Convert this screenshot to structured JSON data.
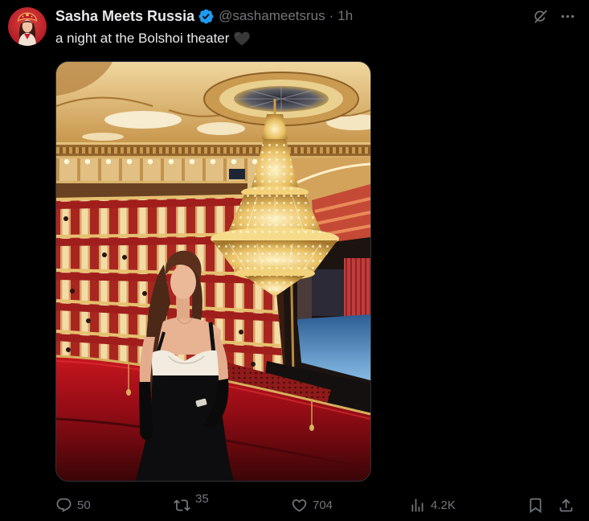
{
  "tweet": {
    "author": {
      "display_name": "Sasha Meets Russia",
      "handle": "@sashameetsrus",
      "separator": "·",
      "time": "1h",
      "avatar_icon": "avatar",
      "verified_icon": "verified-badge-icon"
    },
    "text": "a night at the Bolshoi theater",
    "emoji_icon": "black-heart-emoji-icon",
    "header_actions": {
      "grok_icon": "grok-icon",
      "more_icon": "more-icon"
    },
    "actions": {
      "reply": {
        "icon": "reply-icon",
        "count": "50"
      },
      "repost": {
        "icon": "repost-icon",
        "count": "35"
      },
      "like": {
        "icon": "like-icon",
        "count": "704"
      },
      "views": {
        "icon": "views-icon",
        "count": "4.2K"
      },
      "bookmark": {
        "icon": "bookmark-icon"
      },
      "share": {
        "icon": "share-icon"
      }
    }
  },
  "colors": {
    "background": "#000000",
    "text_primary": "#e7e9ea",
    "text_secondary": "#71767b",
    "verified": "#1d9bf0",
    "border": "#2f3336"
  }
}
